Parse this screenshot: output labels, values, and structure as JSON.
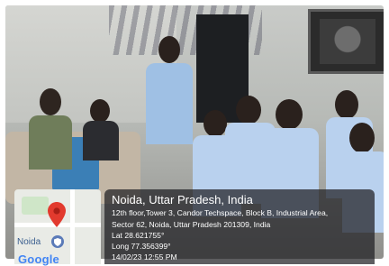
{
  "map": {
    "place_label": "Noida",
    "logo_text": "Google"
  },
  "location_overlay": {
    "title": "Noida, Uttar Pradesh, India",
    "address_line1": "12th floor,Tower 3, Candor Techspace, Block B, Industrial Area,",
    "address_line2": "Sector 62, Noida, Uttar Pradesh 201309, India",
    "latitude": "Lat 28.621755°",
    "longitude": "Long 77.356399°",
    "timestamp": "14/02/23 12:55 PM"
  }
}
